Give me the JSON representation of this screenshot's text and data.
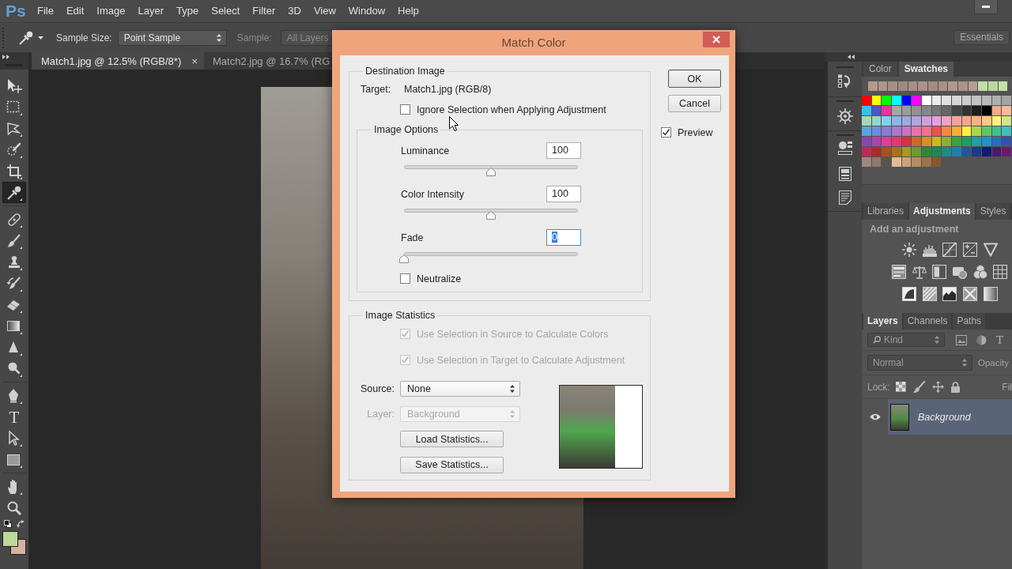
{
  "menu_bar": {
    "logo": "Ps",
    "items": [
      "File",
      "Edit",
      "Image",
      "Layer",
      "Type",
      "Select",
      "Filter",
      "3D",
      "View",
      "Window",
      "Help"
    ]
  },
  "options_bar": {
    "fields": [
      {
        "label": "Sample Size:",
        "value": "Point Sample",
        "disabled": false
      },
      {
        "label": "Sample:",
        "value": "All Layers",
        "disabled": true
      }
    ],
    "workspace": "Essentials"
  },
  "document_tabs": [
    {
      "title": "Match1.jpg @ 12.5% (RGB/8*)",
      "close": "×",
      "selected": true
    },
    {
      "title": "Match2.jpg @ 16.7% (RG",
      "selected": false
    }
  ],
  "tool_groups": [
    [
      {
        "kind": "move",
        "selected": false
      },
      {
        "kind": "marquee",
        "selected": false
      },
      {
        "kind": "lasso",
        "selected": false
      },
      {
        "kind": "quick-select",
        "selected": false
      },
      {
        "kind": "crop",
        "selected": false
      },
      {
        "kind": "eyedropper",
        "selected": true
      }
    ],
    [
      {
        "kind": "healing",
        "selected": false
      },
      {
        "kind": "brush",
        "selected": false
      },
      {
        "kind": "stamp",
        "selected": false
      },
      {
        "kind": "history-brush",
        "selected": false
      },
      {
        "kind": "eraser",
        "selected": false
      },
      {
        "kind": "gradient",
        "selected": false
      },
      {
        "kind": "blur",
        "selected": false
      },
      {
        "kind": "dodge",
        "selected": false
      }
    ],
    [
      {
        "kind": "pen",
        "selected": false
      },
      {
        "kind": "type",
        "label": "T",
        "selected": false
      },
      {
        "kind": "path-select",
        "selected": false
      },
      {
        "kind": "shape",
        "selected": false
      }
    ],
    [
      {
        "kind": "hand",
        "selected": false
      },
      {
        "kind": "zoom",
        "selected": false
      }
    ]
  ],
  "swatches_panel": {
    "tabs": [
      {
        "label": "Color",
        "selected": false
      },
      {
        "label": "Swatches",
        "selected": true
      }
    ],
    "recent": [
      {
        "color": "#b39a91"
      },
      {
        "color": "#ad958c"
      },
      {
        "color": "#a88f86"
      },
      {
        "color": "#a0897f"
      },
      {
        "color": "#a78e86"
      },
      {
        "color": "#ab928a"
      },
      {
        "color": "#a48c84"
      },
      {
        "color": "#a99088"
      },
      {
        "color": "#b0978f"
      },
      {
        "color": "#ab938b"
      },
      {
        "color": "#b59d95"
      },
      {
        "color": "#c2dea3"
      },
      {
        "color": "#bcd99c"
      },
      {
        "color": "#c5e1a7"
      }
    ],
    "grid": [
      [
        {
          "color": "#ff0000"
        },
        {
          "color": "#ffff00"
        },
        {
          "color": "#00ff00"
        },
        {
          "color": "#00ffff"
        },
        {
          "color": "#0000ff"
        },
        {
          "color": "#ff00ff"
        },
        {
          "color": "#ffffff"
        },
        {
          "color": "#ebebeb"
        },
        {
          "color": "#e1e1e1"
        },
        {
          "color": "#d7d7d7"
        },
        {
          "color": "#cdcdcd"
        },
        {
          "color": "#c3c3c3"
        },
        {
          "color": "#b9b9b9"
        },
        {
          "color": "#afafaf"
        },
        {
          "color": "#a5a5a5"
        }
      ],
      [
        {
          "color": "#36c0f0"
        },
        {
          "color": "#4f55c8"
        },
        {
          "color": "#ee3399"
        },
        {
          "color": "#a6a6a6"
        },
        {
          "color": "#9c9c9c"
        },
        {
          "color": "#929292"
        },
        {
          "color": "#878787"
        },
        {
          "color": "#777777"
        },
        {
          "color": "#676767"
        },
        {
          "color": "#454545"
        },
        {
          "color": "#333333"
        },
        {
          "color": "#1d1d1d"
        },
        {
          "color": "#000000"
        },
        {
          "color": "#f7a88a"
        },
        {
          "color": "#f9bb94"
        }
      ],
      [
        {
          "color": "#a3d9b1"
        },
        {
          "color": "#8fd6d0"
        },
        {
          "color": "#7fd3ef"
        },
        {
          "color": "#8cb7e8"
        },
        {
          "color": "#9fa9e2"
        },
        {
          "color": "#b5a4df"
        },
        {
          "color": "#cca2de"
        },
        {
          "color": "#e3a2da"
        },
        {
          "color": "#f2a0c4"
        },
        {
          "color": "#f6a1a1"
        },
        {
          "color": "#f7a48a"
        },
        {
          "color": "#f9b27c"
        },
        {
          "color": "#fcc97a"
        },
        {
          "color": "#fff27f"
        },
        {
          "color": "#cfe58b"
        }
      ],
      [
        {
          "color": "#55a5df"
        },
        {
          "color": "#6a8ddf"
        },
        {
          "color": "#8b7ad6"
        },
        {
          "color": "#ab77cf"
        },
        {
          "color": "#cb72c6"
        },
        {
          "color": "#e772ac"
        },
        {
          "color": "#f2728a"
        },
        {
          "color": "#f0504c"
        },
        {
          "color": "#f58a3f"
        },
        {
          "color": "#f9ae32"
        },
        {
          "color": "#fff33a"
        },
        {
          "color": "#a9d84a"
        },
        {
          "color": "#5fc865"
        },
        {
          "color": "#3dbf91"
        },
        {
          "color": "#3fbfbe"
        }
      ],
      [
        {
          "color": "#8847ad"
        },
        {
          "color": "#a845ad"
        },
        {
          "color": "#df3e9c"
        },
        {
          "color": "#e23a70"
        },
        {
          "color": "#d73341"
        },
        {
          "color": "#c86a2b"
        },
        {
          "color": "#d68f24"
        },
        {
          "color": "#c9b724"
        },
        {
          "color": "#89b035"
        },
        {
          "color": "#3fa043"
        },
        {
          "color": "#1f9f62"
        },
        {
          "color": "#1fa0a0"
        },
        {
          "color": "#2590c9"
        },
        {
          "color": "#2470bf"
        },
        {
          "color": "#3253b0"
        }
      ],
      [
        {
          "color": "#bf295a"
        },
        {
          "color": "#ae2a2a"
        },
        {
          "color": "#a6521f"
        },
        {
          "color": "#a8711b"
        },
        {
          "color": "#a69a20"
        },
        {
          "color": "#6f9932"
        },
        {
          "color": "#2f8838"
        },
        {
          "color": "#1f8858"
        },
        {
          "color": "#1f8888"
        },
        {
          "color": "#1f7faf"
        },
        {
          "color": "#205898"
        },
        {
          "color": "#1b3a89"
        },
        {
          "color": "#131b72"
        },
        {
          "color": "#4a1a72"
        },
        {
          "color": "#6b1a6b"
        }
      ],
      [
        {
          "color": "#a0887c"
        },
        {
          "color": "#8c7a6e"
        },
        {
          "color": "#5c524c"
        },
        {
          "color": "#e2bc94"
        },
        {
          "color": "#caa47c"
        },
        {
          "color": "#b48c64"
        },
        {
          "color": "#9c7448"
        },
        {
          "color": "#84592f"
        }
      ]
    ]
  },
  "adjustments_panel": {
    "tabs": [
      {
        "label": "Libraries",
        "selected": false
      },
      {
        "label": "Adjustments",
        "selected": true
      },
      {
        "label": "Styles",
        "selected": false
      }
    ],
    "heading": "Add an adjustment"
  },
  "layers_panel": {
    "tabs": [
      {
        "label": "Layers",
        "selected": true
      },
      {
        "label": "Channels",
        "selected": false
      },
      {
        "label": "Paths",
        "selected": false
      }
    ],
    "filter": "Kind",
    "type_filter": "T",
    "blend_mode": "Normal",
    "opacity_label": "Opacity",
    "lock_label": "Lock:",
    "fill_label": "Fil",
    "layers": [
      {
        "name": "Background",
        "visible": true,
        "selected": true
      }
    ]
  },
  "dialog": {
    "title": "Match Color",
    "destination": {
      "legend": "Destination Image",
      "target_label": "Target:",
      "target": "Match1.jpg (RGB/8)",
      "ignore_selection": {
        "label": "Ignore Selection when Applying Adjustment",
        "checked": false
      },
      "image_options": {
        "legend": "Image Options",
        "sliders": [
          {
            "label": "Luminance",
            "value": "100",
            "level": 0.5,
            "focused": false
          },
          {
            "label": "Color Intensity",
            "value": "100",
            "level": 0.5,
            "focused": false
          },
          {
            "label": "Fade",
            "value": "0",
            "level": 0,
            "focused": true
          }
        ],
        "neutralize": {
          "label": "Neutralize",
          "checked": false
        }
      }
    },
    "statistics": {
      "legend": "Image Statistics",
      "options": [
        {
          "label": "Use Selection in Source to Calculate Colors",
          "checked": true,
          "disabled": true
        },
        {
          "label": "Use Selection in Target to Calculate Adjustment",
          "checked": true,
          "disabled": true
        }
      ],
      "selects": [
        {
          "label": "Source:",
          "value": "None",
          "disabled": false
        },
        {
          "label": "Layer:",
          "value": "Background",
          "disabled": true
        }
      ],
      "buttons": [
        "Load Statistics...",
        "Save Statistics..."
      ]
    },
    "buttons": [
      {
        "label": "OK",
        "default": true
      },
      {
        "label": "Cancel",
        "default": false
      }
    ],
    "preview": {
      "label": "Preview",
      "checked": true
    }
  }
}
